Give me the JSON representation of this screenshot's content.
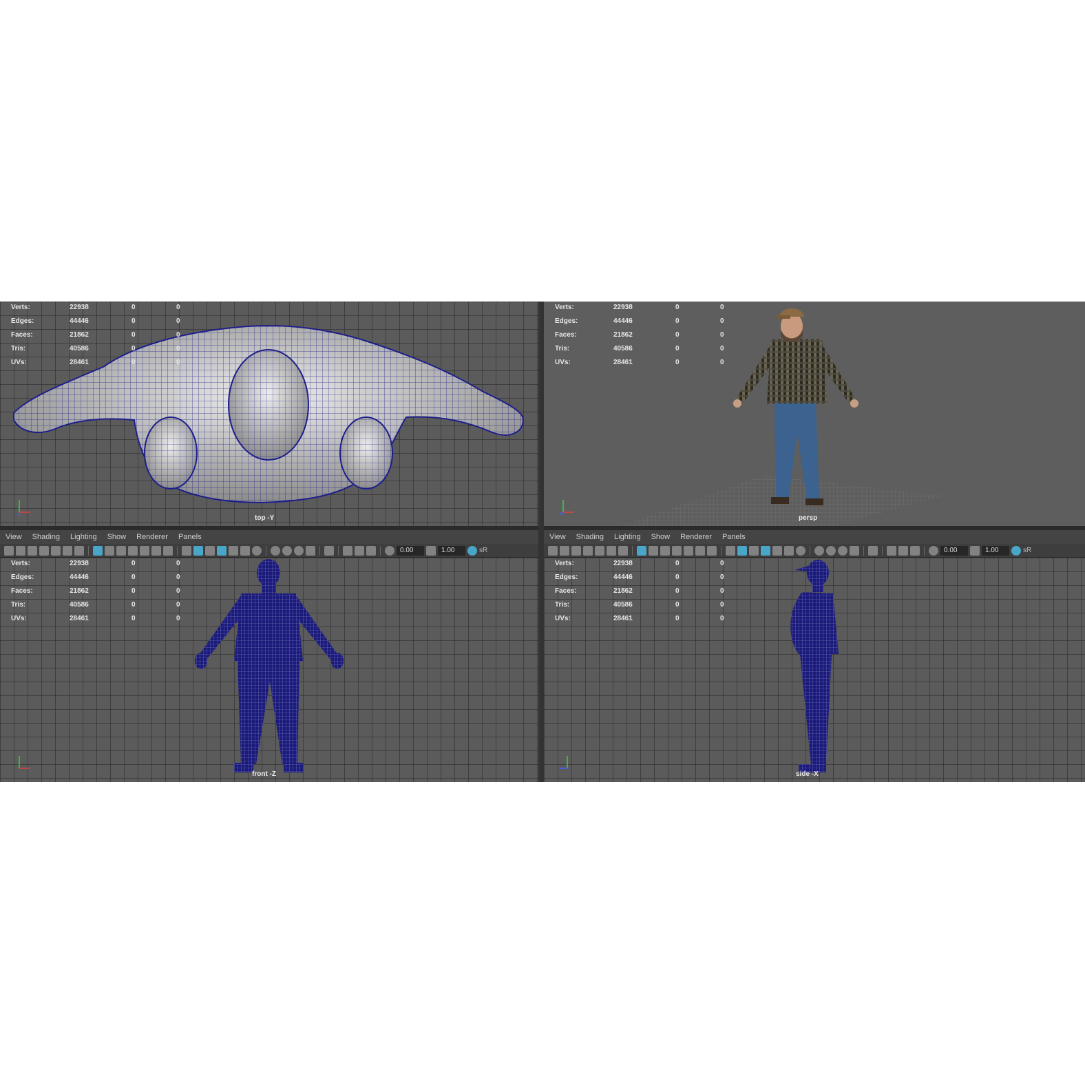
{
  "menu": [
    "View",
    "Shading",
    "Lighting",
    "Show",
    "Renderer",
    "Panels"
  ],
  "toolbar": {
    "field_a": "0.00",
    "field_b": "1.00",
    "badge": "sR"
  },
  "stats": [
    {
      "label": "Verts:",
      "v1": "22938",
      "v2": "0",
      "v3": "0"
    },
    {
      "label": "Edges:",
      "v1": "44446",
      "v2": "0",
      "v3": "0"
    },
    {
      "label": "Faces:",
      "v1": "21862",
      "v2": "0",
      "v3": "0"
    },
    {
      "label": "Tris:",
      "v1": "40586",
      "v2": "0",
      "v3": "0"
    },
    {
      "label": "UVs:",
      "v1": "28461",
      "v2": "0",
      "v3": "0"
    }
  ],
  "viewports": {
    "top": {
      "camera": "top -Y"
    },
    "persp": {
      "camera": "persp"
    },
    "front": {
      "camera": "front -Z"
    },
    "side": {
      "camera": "side -X"
    }
  },
  "colors": {
    "wire": "#1e1e8c",
    "accent": "#4aa6c8",
    "viewport_bg": "#5b5b5b"
  },
  "icons": [
    "camera-icon",
    "grid-icon",
    "wireframe-icon",
    "smooth-shade-icon",
    "light-icon",
    "isolate-icon"
  ]
}
